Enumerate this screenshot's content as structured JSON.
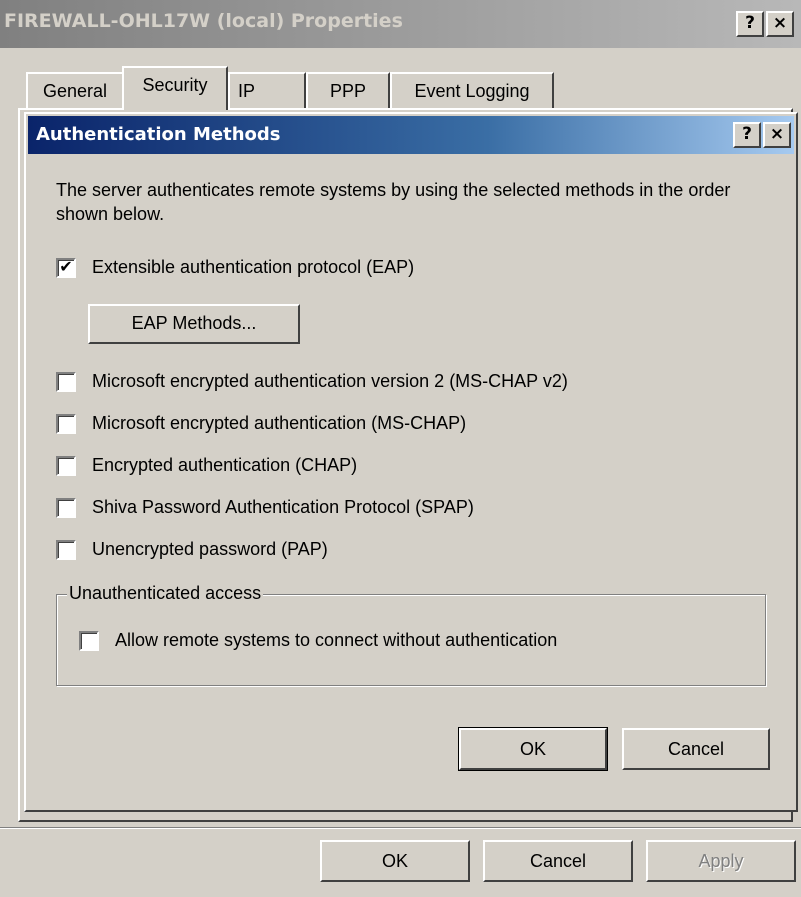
{
  "outer": {
    "title": "FIREWALL-OHL17W (local) Properties",
    "help_label": "?",
    "close_label": "×",
    "tabs": [
      {
        "label": "General"
      },
      {
        "label": "Security"
      },
      {
        "label": "IP"
      },
      {
        "label": "PPP"
      },
      {
        "label": "Event Logging"
      }
    ],
    "active_tab": "Security",
    "buttons": {
      "ok": "OK",
      "cancel": "Cancel",
      "apply": "Apply"
    }
  },
  "dialog": {
    "title": "Authentication Methods",
    "help_label": "?",
    "close_label": "×",
    "description": "The server authenticates remote systems by using the selected methods in the order shown below.",
    "eap": {
      "label": "Extensible authentication protocol (EAP)",
      "checked": true
    },
    "eap_methods_button": "EAP Methods...",
    "methods": [
      {
        "label": "Microsoft encrypted authentication version 2 (MS-CHAP v2)",
        "checked": false
      },
      {
        "label": "Microsoft encrypted authentication (MS-CHAP)",
        "checked": false
      },
      {
        "label": "Encrypted authentication (CHAP)",
        "checked": false
      },
      {
        "label": "Shiva Password Authentication Protocol (SPAP)",
        "checked": false
      },
      {
        "label": "Unencrypted password (PAP)",
        "checked": false
      }
    ],
    "unauth_group": {
      "legend": "Unauthenticated access",
      "allow": {
        "label": "Allow remote systems to connect without authentication",
        "checked": false
      }
    },
    "buttons": {
      "ok": "OK",
      "cancel": "Cancel"
    }
  },
  "check_glyph": "✔",
  "colors": {
    "dialog_title_start": "#0a246a",
    "dialog_title_end": "#a6caf0",
    "face": "#d4d0c8"
  }
}
